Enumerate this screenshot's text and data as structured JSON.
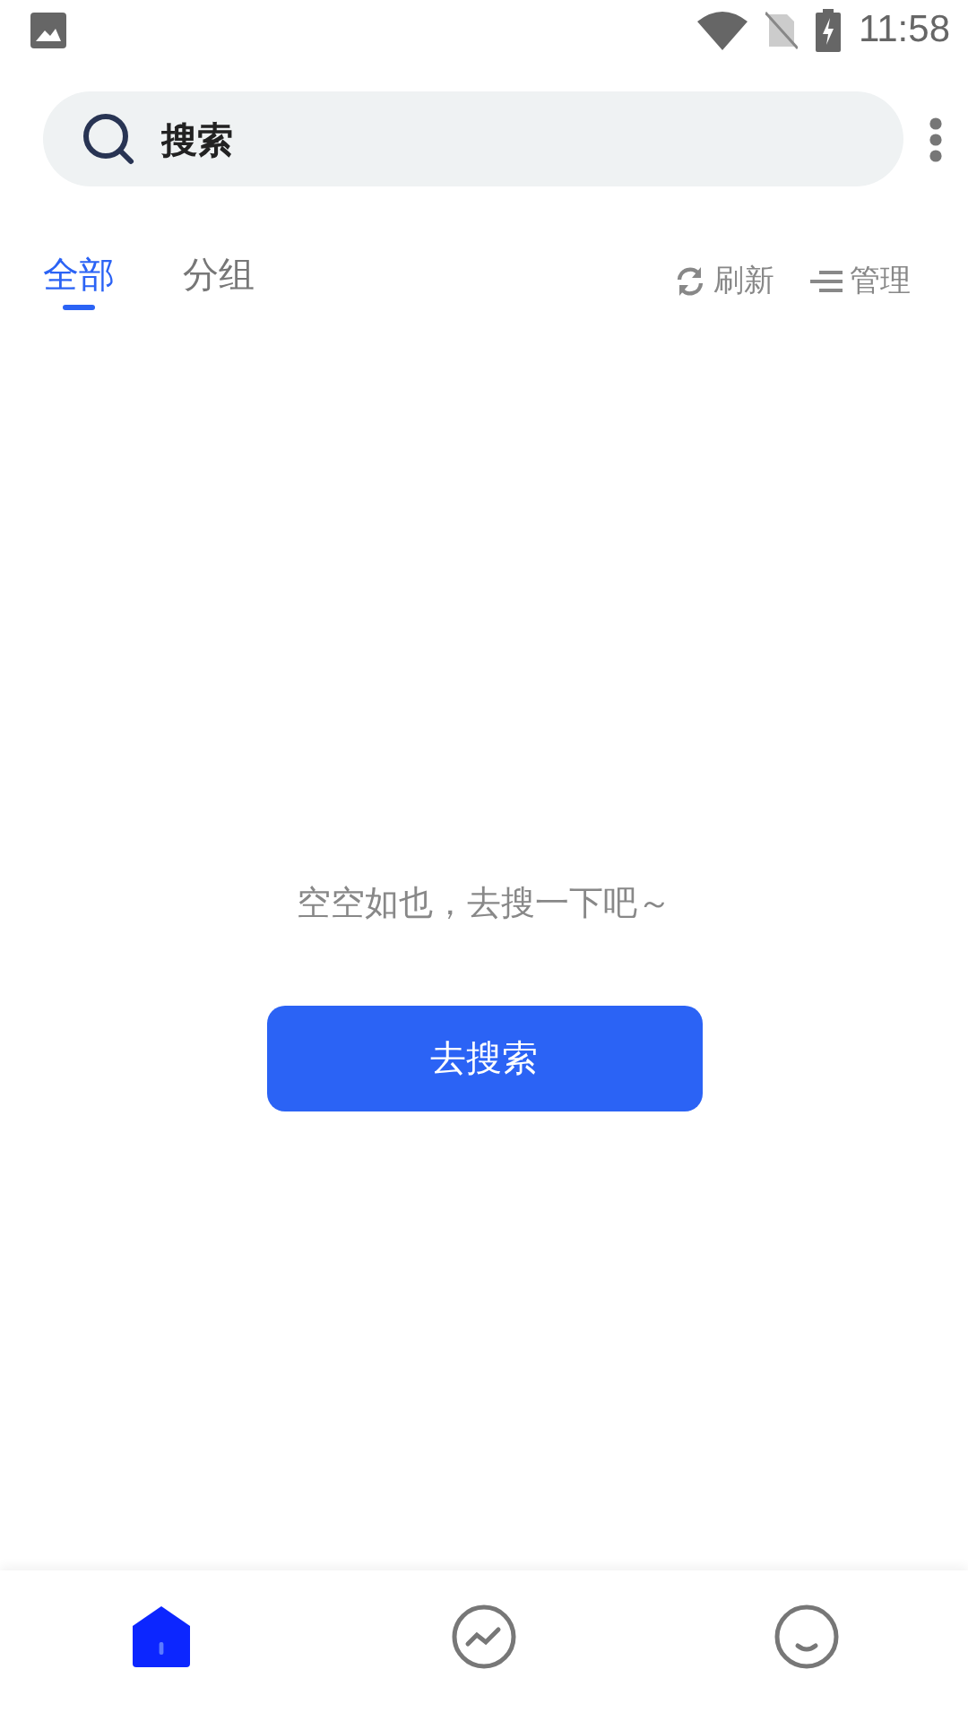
{
  "status_bar": {
    "time": "11:58"
  },
  "search": {
    "placeholder": "搜索"
  },
  "tabs": [
    {
      "label": "全部",
      "selected": true
    },
    {
      "label": "分组",
      "selected": false
    }
  ],
  "actions": [
    {
      "kind": "refresh",
      "label": "刷新"
    },
    {
      "kind": "manage",
      "label": "管理"
    }
  ],
  "empty_state": {
    "message": "空空如也，去搜一下吧～",
    "button": "去搜索"
  },
  "bottom_nav": [
    {
      "kind": "home",
      "selected": true
    },
    {
      "kind": "trend",
      "selected": false
    },
    {
      "kind": "profile",
      "selected": false
    }
  ]
}
